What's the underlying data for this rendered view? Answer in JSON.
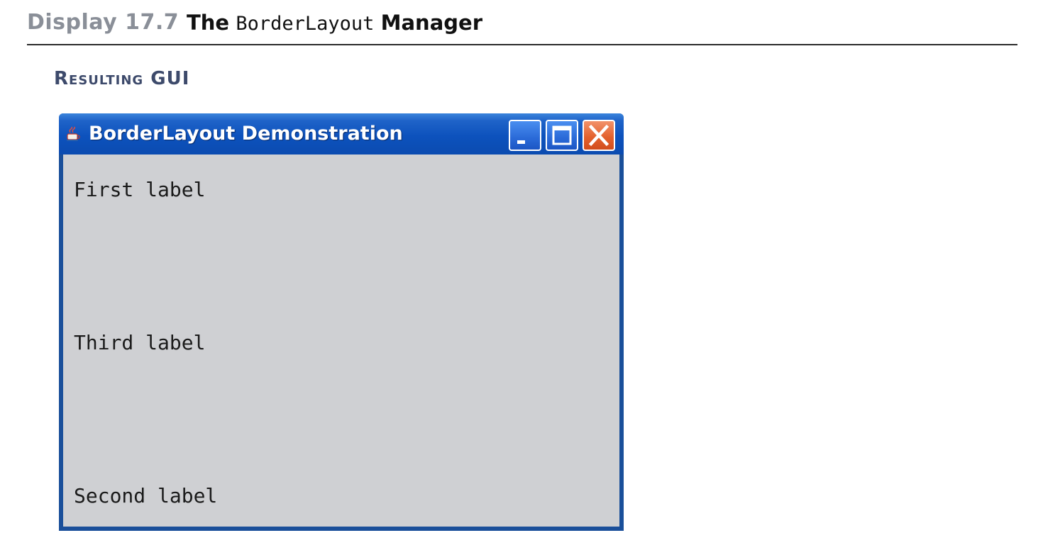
{
  "display": {
    "number": "Display 17.7",
    "title_prefix": "The",
    "title_code": "BorderLayout",
    "title_suffix": "Manager"
  },
  "section": {
    "heading": "Resulting GUI"
  },
  "window": {
    "title": "BorderLayout Demonstration",
    "icons": {
      "app": "java-app-icon",
      "minimize": "minimize-icon",
      "maximize": "maximize-icon",
      "close": "close-icon"
    },
    "colors": {
      "titlebar": "#0d52bd",
      "frame": "#1a4f9a",
      "content": "#cfd0d3",
      "close_button": "#e4622f"
    },
    "labels": {
      "north": "First label",
      "center": "Third label",
      "south": "Second label"
    }
  }
}
